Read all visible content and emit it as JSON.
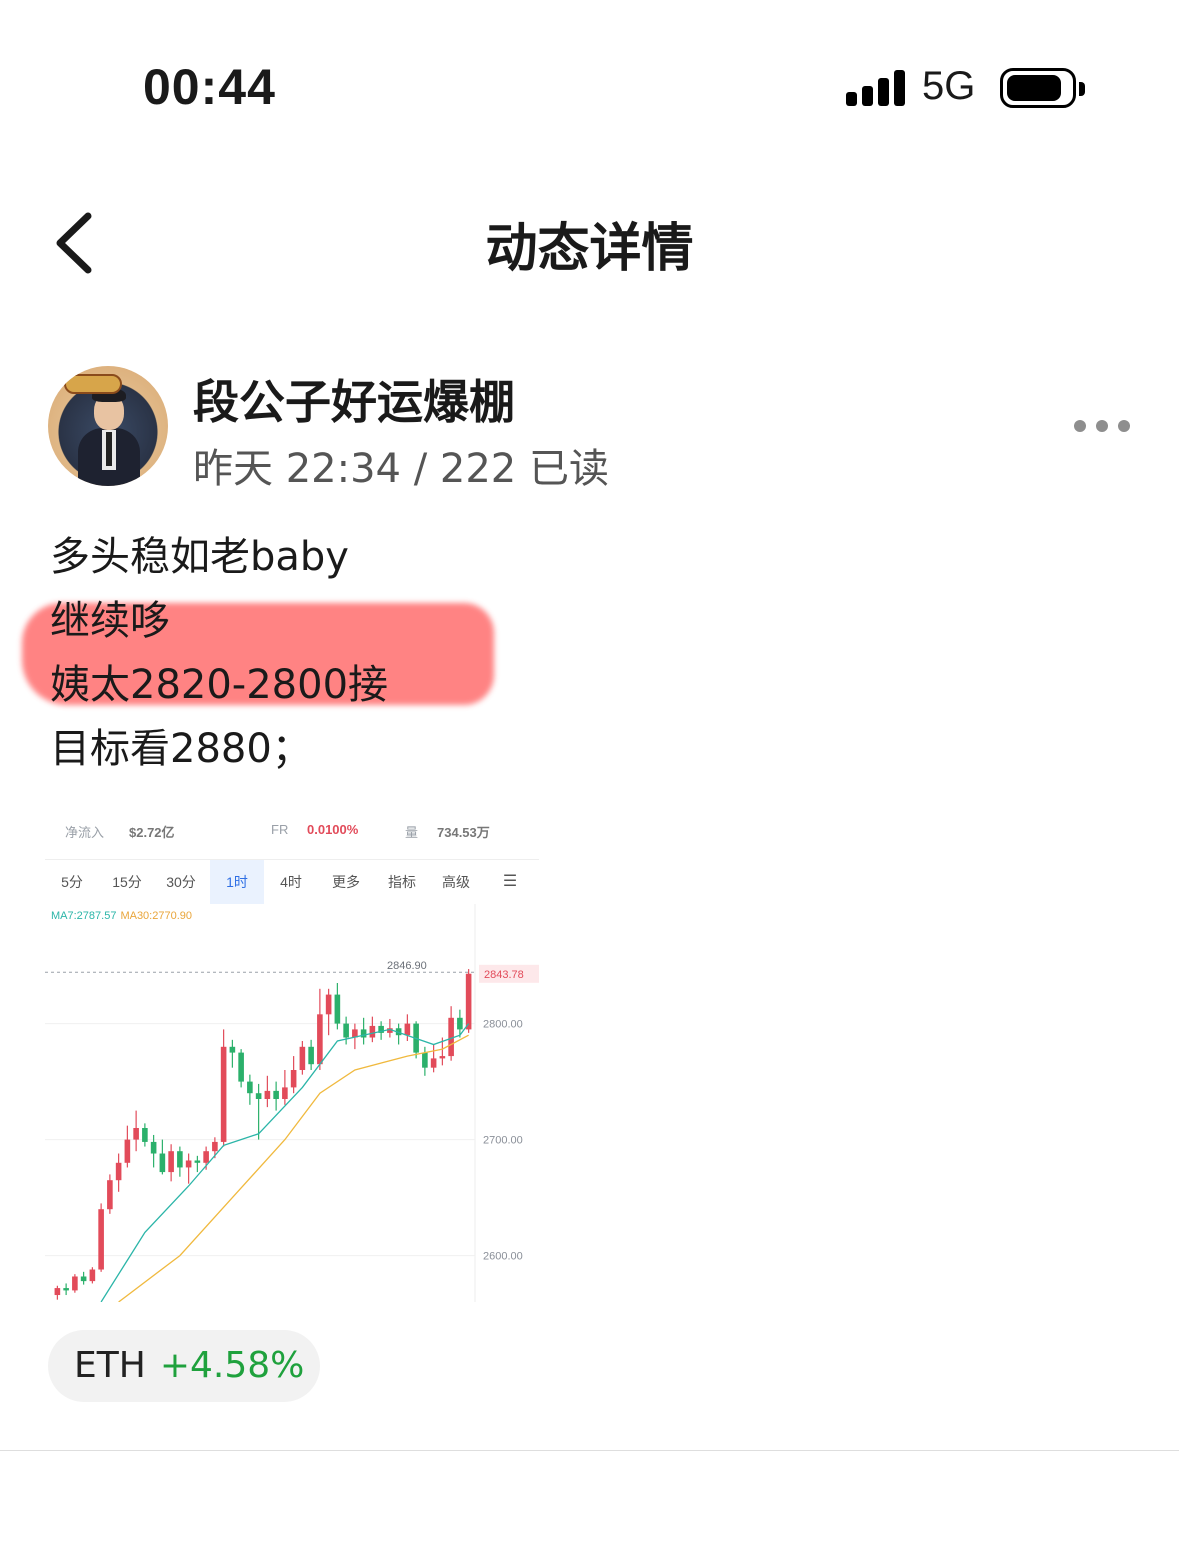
{
  "status_bar": {
    "time": "00:44",
    "network": "5G"
  },
  "nav": {
    "title": "动态详情"
  },
  "author": {
    "name": "段公子好运爆棚",
    "meta": "昨天 22:34 / 222 已读"
  },
  "post": {
    "lines": [
      "多头稳如老baby",
      "继续哆",
      "姨太2820-2800接",
      "目标看2880；"
    ]
  },
  "screenshot": {
    "top_labels": [
      "净流入",
      "$2.72亿",
      "FR",
      "0.0100%",
      "量",
      "734.53万"
    ],
    "tabs": [
      "5分",
      "15分",
      "30分",
      "1时",
      "4时",
      "更多",
      "指标",
      "高级"
    ],
    "active_tab": "1时",
    "ma7": "MA7:2787.57",
    "ma30": "MA30:2770.90",
    "high_label": "2846.90",
    "price_label": "2843.78",
    "chart_data": {
      "type": "candlestick",
      "y_ticks": [
        "2800.00",
        "2700.00",
        "2600.00"
      ],
      "ylim": [
        2560,
        2885
      ],
      "candles": [
        [
          2566,
          2572,
          2562,
          2574
        ],
        [
          2572,
          2570,
          2566,
          2576
        ],
        [
          2570,
          2582,
          2568,
          2584
        ],
        [
          2582,
          2578,
          2575,
          2586
        ],
        [
          2578,
          2588,
          2576,
          2590
        ],
        [
          2588,
          2640,
          2586,
          2645
        ],
        [
          2640,
          2665,
          2636,
          2670
        ],
        [
          2665,
          2680,
          2655,
          2688
        ],
        [
          2680,
          2700,
          2676,
          2712
        ],
        [
          2700,
          2710,
          2690,
          2725
        ],
        [
          2710,
          2698,
          2694,
          2714
        ],
        [
          2698,
          2688,
          2676,
          2704
        ],
        [
          2688,
          2672,
          2670,
          2700
        ],
        [
          2672,
          2690,
          2664,
          2696
        ],
        [
          2690,
          2676,
          2668,
          2694
        ],
        [
          2676,
          2682,
          2662,
          2688
        ],
        [
          2682,
          2680,
          2672,
          2686
        ],
        [
          2680,
          2690,
          2674,
          2694
        ],
        [
          2690,
          2698,
          2684,
          2702
        ],
        [
          2698,
          2780,
          2694,
          2795
        ],
        [
          2780,
          2775,
          2762,
          2786
        ],
        [
          2775,
          2750,
          2745,
          2778
        ],
        [
          2750,
          2740,
          2730,
          2756
        ],
        [
          2740,
          2735,
          2700,
          2748
        ],
        [
          2735,
          2742,
          2728,
          2755
        ],
        [
          2742,
          2735,
          2725,
          2750
        ],
        [
          2735,
          2745,
          2730,
          2760
        ],
        [
          2745,
          2760,
          2740,
          2772
        ],
        [
          2760,
          2780,
          2756,
          2785
        ],
        [
          2780,
          2765,
          2760,
          2786
        ],
        [
          2765,
          2808,
          2760,
          2830
        ],
        [
          2808,
          2825,
          2790,
          2830
        ],
        [
          2825,
          2800,
          2795,
          2835
        ],
        [
          2800,
          2788,
          2782,
          2806
        ],
        [
          2788,
          2795,
          2778,
          2800
        ],
        [
          2795,
          2788,
          2782,
          2805
        ],
        [
          2788,
          2798,
          2784,
          2806
        ],
        [
          2798,
          2792,
          2786,
          2802
        ],
        [
          2792,
          2796,
          2788,
          2804
        ],
        [
          2796,
          2790,
          2782,
          2800
        ],
        [
          2790,
          2800,
          2785,
          2808
        ],
        [
          2800,
          2775,
          2770,
          2802
        ],
        [
          2775,
          2762,
          2755,
          2780
        ],
        [
          2762,
          2770,
          2758,
          2782
        ],
        [
          2770,
          2772,
          2764,
          2788
        ],
        [
          2772,
          2805,
          2768,
          2815
        ],
        [
          2805,
          2795,
          2788,
          2812
        ],
        [
          2795,
          2843,
          2792,
          2847
        ]
      ],
      "ma7_points": [
        [
          5,
          2560
        ],
        [
          10,
          2620
        ],
        [
          15,
          2660
        ],
        [
          19,
          2695
        ],
        [
          23,
          2705
        ],
        [
          28,
          2745
        ],
        [
          32,
          2785
        ],
        [
          38,
          2795
        ],
        [
          43,
          2782
        ],
        [
          46,
          2790
        ],
        [
          47,
          2800
        ]
      ],
      "ma30_points": [
        [
          7,
          2560
        ],
        [
          14,
          2600
        ],
        [
          20,
          2650
        ],
        [
          26,
          2700
        ],
        [
          30,
          2740
        ],
        [
          34,
          2760
        ],
        [
          40,
          2772
        ],
        [
          44,
          2778
        ],
        [
          47,
          2790
        ]
      ]
    }
  },
  "asset_tag": {
    "symbol": "ETH",
    "change": "+4.58%"
  },
  "colors": {
    "up": "#e24b5a",
    "down": "#2bb06b",
    "gain_text": "#1fa13d",
    "highlight": "#ff6e6e"
  },
  "icons": [
    "signal-icon",
    "battery-icon",
    "back-chevron-icon",
    "more-dots-icon"
  ]
}
